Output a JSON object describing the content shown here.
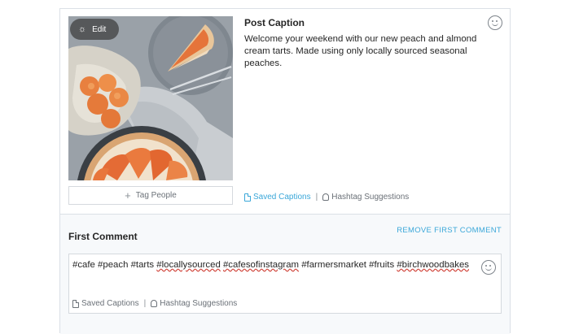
{
  "post": {
    "edit_label": "Edit",
    "tag_people_label": "Tag People",
    "caption_title": "Post Caption",
    "caption_text": "Welcome your weekend with our new peach and almond cream tarts. Made using only locally sourced seasonal peaches.",
    "saved_captions_label": "Saved Captions",
    "separator": "|",
    "hashtag_suggestions_label": "Hashtag Suggestions"
  },
  "first_comment": {
    "title": "First Comment",
    "remove_label": "REMOVE FIRST COMMENT",
    "hashtags": [
      "#cafe",
      "#peach",
      "#tarts",
      "#locallysourced",
      "#cafesofinstagram",
      "#farmersmarket",
      "#fruits",
      "#birchwoodbakes"
    ],
    "saved_captions_label": "Saved Captions",
    "separator": "|",
    "hashtag_suggestions_label": "Hashtag Suggestions"
  },
  "colors": {
    "link": "#3aa7d9",
    "border": "#dbe0e6",
    "section_bg": "#f7f9fb"
  },
  "icons": {
    "edit": "sun-icon",
    "tag_people": "plus-icon",
    "emoji": "smiley-icon",
    "saved_captions": "document-icon",
    "hashtag_suggestions": "lightbulb-icon"
  }
}
